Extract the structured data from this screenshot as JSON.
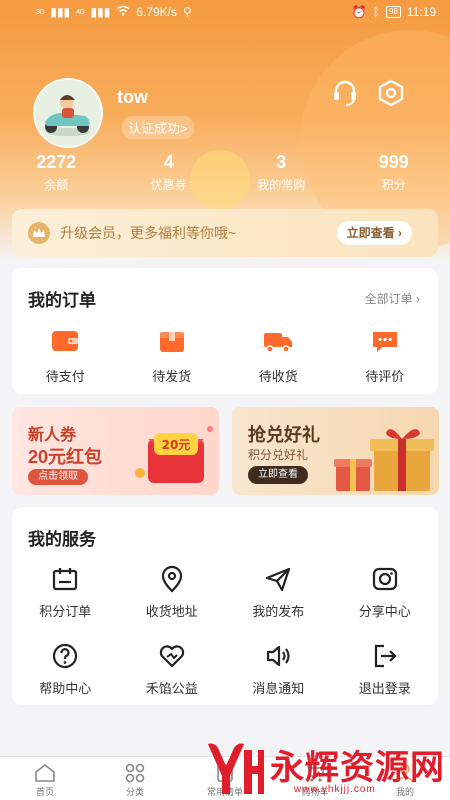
{
  "status_bar": {
    "signal1": "3G",
    "signal2": "4G",
    "speed": "6.79K/s",
    "battery": "98",
    "time": "11:19"
  },
  "profile": {
    "username": "tow",
    "verify_label": "认证成功>"
  },
  "stats": [
    {
      "value": "2272",
      "label": "余额"
    },
    {
      "value": "4",
      "label": "优惠券"
    },
    {
      "value": "3",
      "label": "我的常购"
    },
    {
      "value": "999",
      "label": "积分"
    }
  ],
  "vip": {
    "text": "升级会员，更多福利等你哦~",
    "button": "立即查看 ›"
  },
  "orders": {
    "title": "我的订单",
    "more": "全部订单 ›",
    "items": [
      {
        "label": "待支付",
        "icon": "wallet-icon"
      },
      {
        "label": "待发货",
        "icon": "package-icon"
      },
      {
        "label": "待收货",
        "icon": "truck-icon"
      },
      {
        "label": "待评价",
        "icon": "comment-icon"
      }
    ]
  },
  "promos": {
    "left": {
      "title": "新人券",
      "subtitle": "20元红包",
      "button": "点击领取",
      "badge": "20元"
    },
    "right": {
      "title": "抢兑好礼",
      "subtitle": "积分兑好礼",
      "button": "立即查看"
    }
  },
  "services": {
    "title": "我的服务",
    "items": [
      {
        "label": "积分订单",
        "icon": "calendar-icon"
      },
      {
        "label": "收货地址",
        "icon": "location-icon"
      },
      {
        "label": "我的发布",
        "icon": "send-icon"
      },
      {
        "label": "分享中心",
        "icon": "camera-icon"
      },
      {
        "label": "帮助中心",
        "icon": "help-icon"
      },
      {
        "label": "禾馅公益",
        "icon": "heart-icon"
      },
      {
        "label": "消息通知",
        "icon": "speaker-icon"
      },
      {
        "label": "退出登录",
        "icon": "logout-icon"
      }
    ]
  },
  "tabbar": [
    {
      "label": "首页",
      "icon": "home-icon"
    },
    {
      "label": "分类",
      "icon": "category-icon"
    },
    {
      "label": "常用清单",
      "icon": "list-icon"
    },
    {
      "label": "购物车",
      "icon": "cart-icon"
    },
    {
      "label": "我的",
      "icon": "user-icon"
    }
  ],
  "watermark": {
    "text": "永辉资源网",
    "url": "www.yhkjjj.com"
  },
  "colors": {
    "primary": "#f59a3f",
    "accent": "#ff6a2a",
    "vip_text": "#b07c3f"
  }
}
